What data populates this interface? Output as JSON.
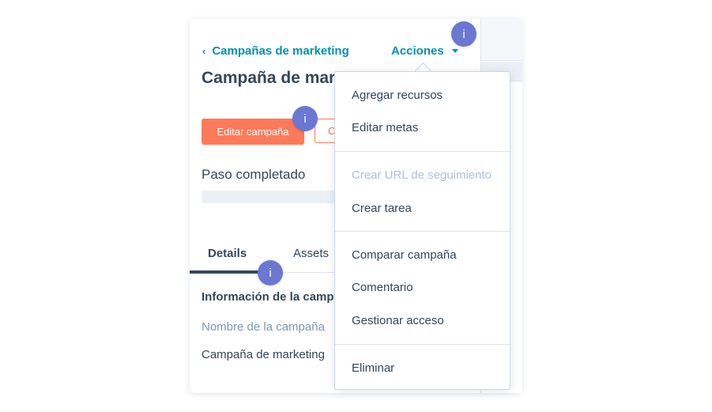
{
  "header": {
    "breadcrumb_chevron": "‹",
    "breadcrumb_label": "Campañas de marketing",
    "actions_label": "Acciones"
  },
  "record": {
    "title": "Campaña de marketing de goteo por correo",
    "primary_button": "Editar campaña",
    "secondary_button": "C",
    "progress_label": "Paso completado"
  },
  "tabs": [
    {
      "label": "Details",
      "active": true
    },
    {
      "label": "Assets",
      "active": false
    }
  ],
  "details": {
    "section_heading": "Información de la campaña",
    "field_label": "Nombre de la campaña",
    "field_value": "Campaña de marketing"
  },
  "menu": {
    "items": [
      {
        "label": "Agregar recursos",
        "disabled": false
      },
      {
        "label": "Editar metas",
        "disabled": false
      },
      {
        "label": "Crear URL de seguimiento",
        "disabled": true
      },
      {
        "label": "Crear tarea",
        "disabled": false
      },
      {
        "label": "Comparar campaña",
        "disabled": false
      },
      {
        "label": "Comentario",
        "disabled": false
      },
      {
        "label": "Gestionar acceso",
        "disabled": false
      },
      {
        "label": "Eliminar",
        "disabled": false
      }
    ]
  },
  "badges": {
    "symbol": "i"
  },
  "colors": {
    "link": "#0091ae",
    "primary_button": "#ff7a59",
    "text": "#33475b",
    "muted": "#7c98b6",
    "disabled": "#b0c1d4",
    "badge": "#6a78d1"
  }
}
